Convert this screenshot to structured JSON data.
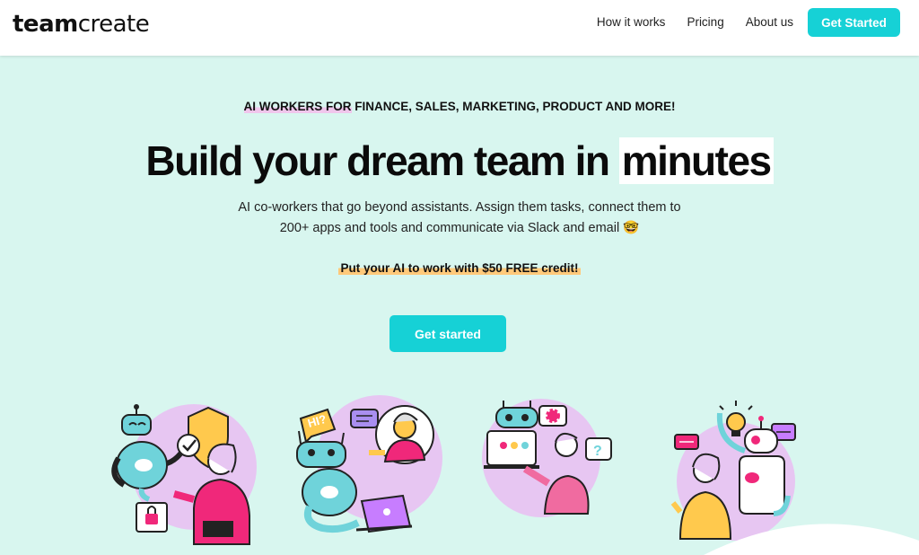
{
  "brand": {
    "logo_bold": "team",
    "logo_light": "create"
  },
  "nav": {
    "links": [
      "How it works",
      "Pricing",
      "About us"
    ],
    "cta_label": "Get Started"
  },
  "hero": {
    "eyebrow_highlight": "AI WORKERS FOR",
    "eyebrow_rest": " FINANCE, SALES, MARKETING, PRODUCT AND MORE!",
    "headline_main": "Build your dream team in ",
    "headline_highlight": "minutes",
    "subtitle": "AI co-workers that go beyond assistants. Assign them tasks, connect them to 200+ apps and tools and communicate via Slack and email 🤓",
    "promo": "Put your AI to work with $50 FREE credit!",
    "cta_label": "Get started"
  },
  "illustrations": {
    "speech_bubble_hi": "HI?",
    "question_mark": "?"
  },
  "colors": {
    "accent": "#16d1d6",
    "background": "#d8f6ef",
    "blob": "#e7c6f2",
    "robot": "#6fd3da",
    "pink": "#f0287a",
    "yellow": "#ffc94d"
  }
}
